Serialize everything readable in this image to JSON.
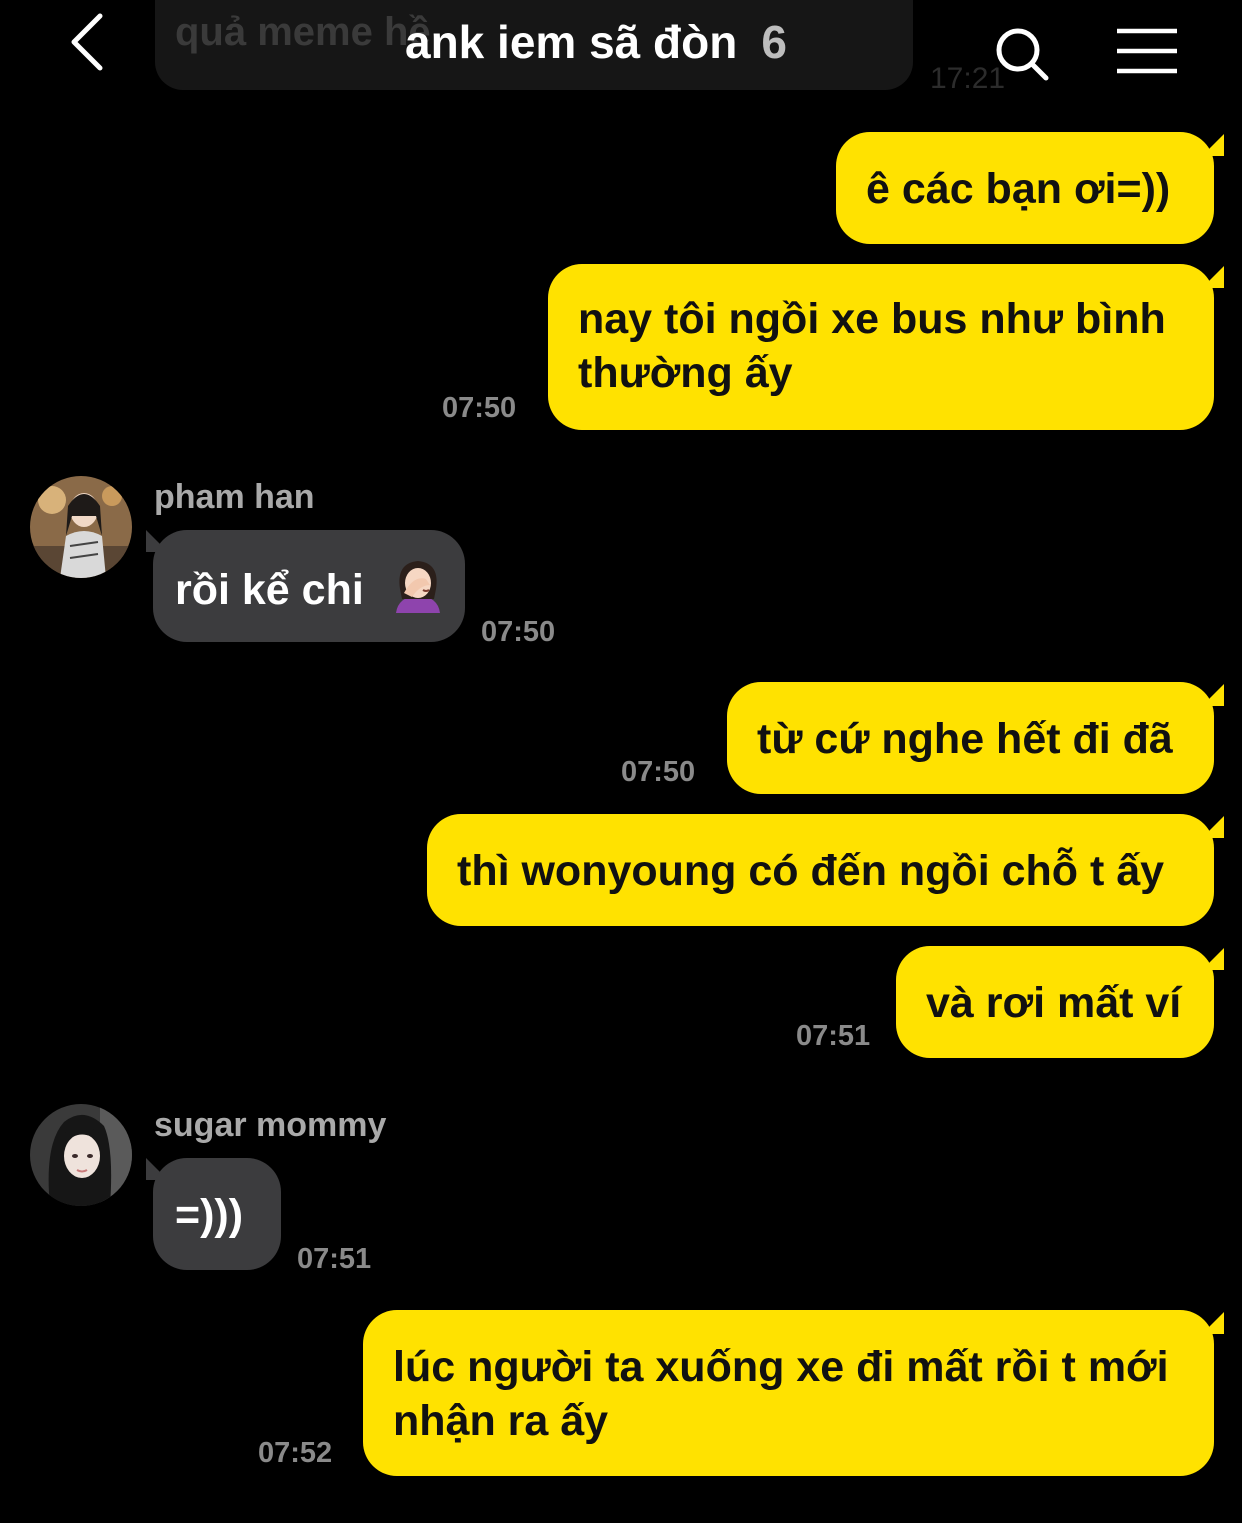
{
  "header": {
    "title": "ank iem sã đòn",
    "member_count": "6",
    "background_message": "quả meme hề",
    "background_time": "17:21"
  },
  "messages": [
    {
      "side": "out",
      "text": "ê các bạn ơi=))",
      "time": ""
    },
    {
      "side": "out",
      "text": "nay tôi ngồi xe bus như bình thường ấy",
      "time": "07:50"
    },
    {
      "side": "in",
      "sender": "pham han",
      "text": "rồi kể chi",
      "emoji": "face-palm-woman-emoji",
      "time": "07:50"
    },
    {
      "side": "out",
      "text": "từ cứ nghe hết đi đã",
      "time": "07:50"
    },
    {
      "side": "out",
      "text": "thì wonyoung có đến ngồi chỗ t ấy",
      "time": ""
    },
    {
      "side": "out",
      "text": "và rơi mất ví",
      "time": "07:51"
    },
    {
      "side": "in",
      "sender": "sugar mommy",
      "text": "=)))",
      "time": "07:51"
    },
    {
      "side": "out",
      "text": "lúc người ta xuống xe đi mất rồi t mới nhận ra ấy",
      "time": "07:52"
    }
  ],
  "colors": {
    "background": "#000000",
    "outgoing_bubble": "#ffe200",
    "incoming_bubble": "#3c3c3e",
    "timestamp": "#8a8a8a"
  },
  "icons": [
    "back-arrow-icon",
    "search-icon",
    "menu-icon"
  ]
}
